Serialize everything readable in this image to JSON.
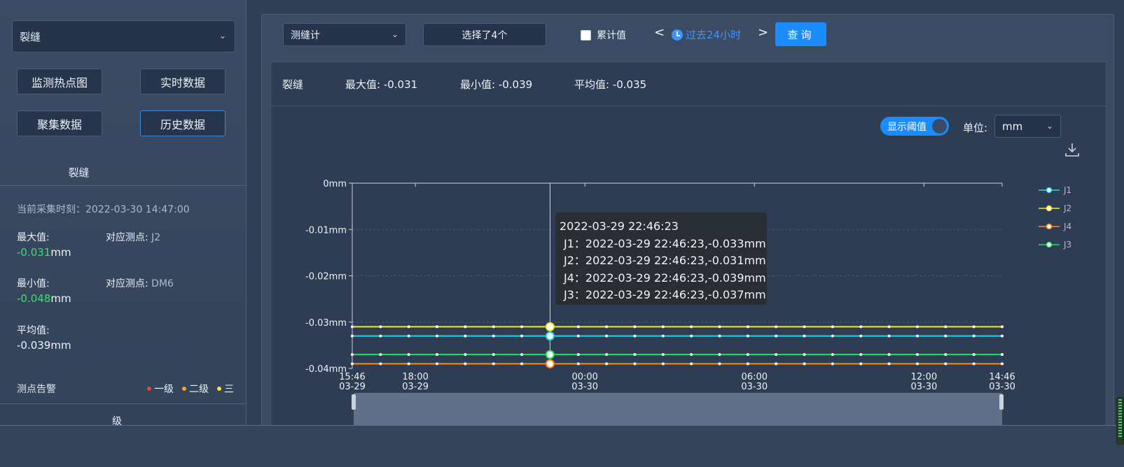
{
  "left": {
    "category_select": "裂缝",
    "buttons": [
      "监测热点图",
      "实时数据",
      "聚集数据",
      "历史数据"
    ],
    "section_title": "裂缝",
    "acquisition_time": "当前采集时刻：2022-03-30 14:47:00",
    "max_label": "最大值:",
    "max_value": "-0.031",
    "max_unit": "mm",
    "max_point_label": "对应测点:",
    "max_point": "J2",
    "min_label": "最小值:",
    "min_value": "-0.048",
    "min_unit": "mm",
    "min_point_label": "对应测点:",
    "min_point": "DM6",
    "avg_label": "平均值:",
    "avg_value": "-0.039mm",
    "alarm_label": "测点告警",
    "alarm_levels": [
      {
        "label": "一级",
        "color": "#e8412c"
      },
      {
        "label": "二级",
        "color": "#f5a623"
      },
      {
        "label": "三",
        "color": "#f5e623"
      }
    ],
    "alarm_level_fragment": "级"
  },
  "toolbar": {
    "type_select": "测缝计",
    "selected_count": "选择了4个",
    "cumulative_label": "累计值",
    "prev": "<",
    "time_range": "过去24小时",
    "next": ">",
    "query_label": "查询"
  },
  "summary": {
    "name": "裂缝",
    "max": "最大值: -0.031",
    "min": "最小值: -0.039",
    "avg": "平均值: -0.035"
  },
  "chart_controls": {
    "threshold_toggle": "显示阈值",
    "unit_label": "单位:",
    "unit_value": "mm"
  },
  "tooltip": {
    "title": "2022-03-29 22:46:23",
    "rows": [
      {
        "text": "J1：2022-03-29 22:46:23,-0.033mm",
        "color": "#22d3f0"
      },
      {
        "text": "J2：2022-03-29 22:46:23,-0.031mm",
        "color": "#f5e623"
      },
      {
        "text": "J4：2022-03-29 22:46:23,-0.039mm",
        "color": "#ff8a1a"
      },
      {
        "text": "J3：2022-03-29 22:46:23,-0.037mm",
        "color": "#22e05a"
      }
    ]
  },
  "chart_data": {
    "type": "line",
    "y_ticks": [
      "0mm",
      "-0.01mm",
      "-0.02mm",
      "-0.03mm",
      "-0.04mm"
    ],
    "ylim": [
      -0.04,
      0
    ],
    "x_ticks": [
      {
        "time": "15:46",
        "date": "03-29",
        "x": "2022-03-29 15:46"
      },
      {
        "time": "18:00",
        "date": "03-29",
        "x": "2022-03-29 18:00"
      },
      {
        "time": "00:00",
        "date": "03-30",
        "x": "2022-03-30 00:00"
      },
      {
        "time": "06:00",
        "date": "03-30",
        "x": "2022-03-30 06:00"
      },
      {
        "time": "12:00",
        "date": "03-30",
        "x": "2022-03-30 12:00"
      },
      {
        "time": "14:46",
        "date": "03-30",
        "x": "2022-03-30 14:46"
      }
    ],
    "xlim": [
      "2022-03-29 15:46",
      "2022-03-30 14:46"
    ],
    "highlight_x": "2022-03-29 22:46",
    "series": [
      {
        "name": "J1",
        "color": "#22d3f0",
        "value": -0.033
      },
      {
        "name": "J2",
        "color": "#f5e623",
        "value": -0.031
      },
      {
        "name": "J4",
        "color": "#ff8a1a",
        "value": -0.039
      },
      {
        "name": "J3",
        "color": "#22e05a",
        "value": -0.037
      }
    ],
    "legend": "right"
  }
}
